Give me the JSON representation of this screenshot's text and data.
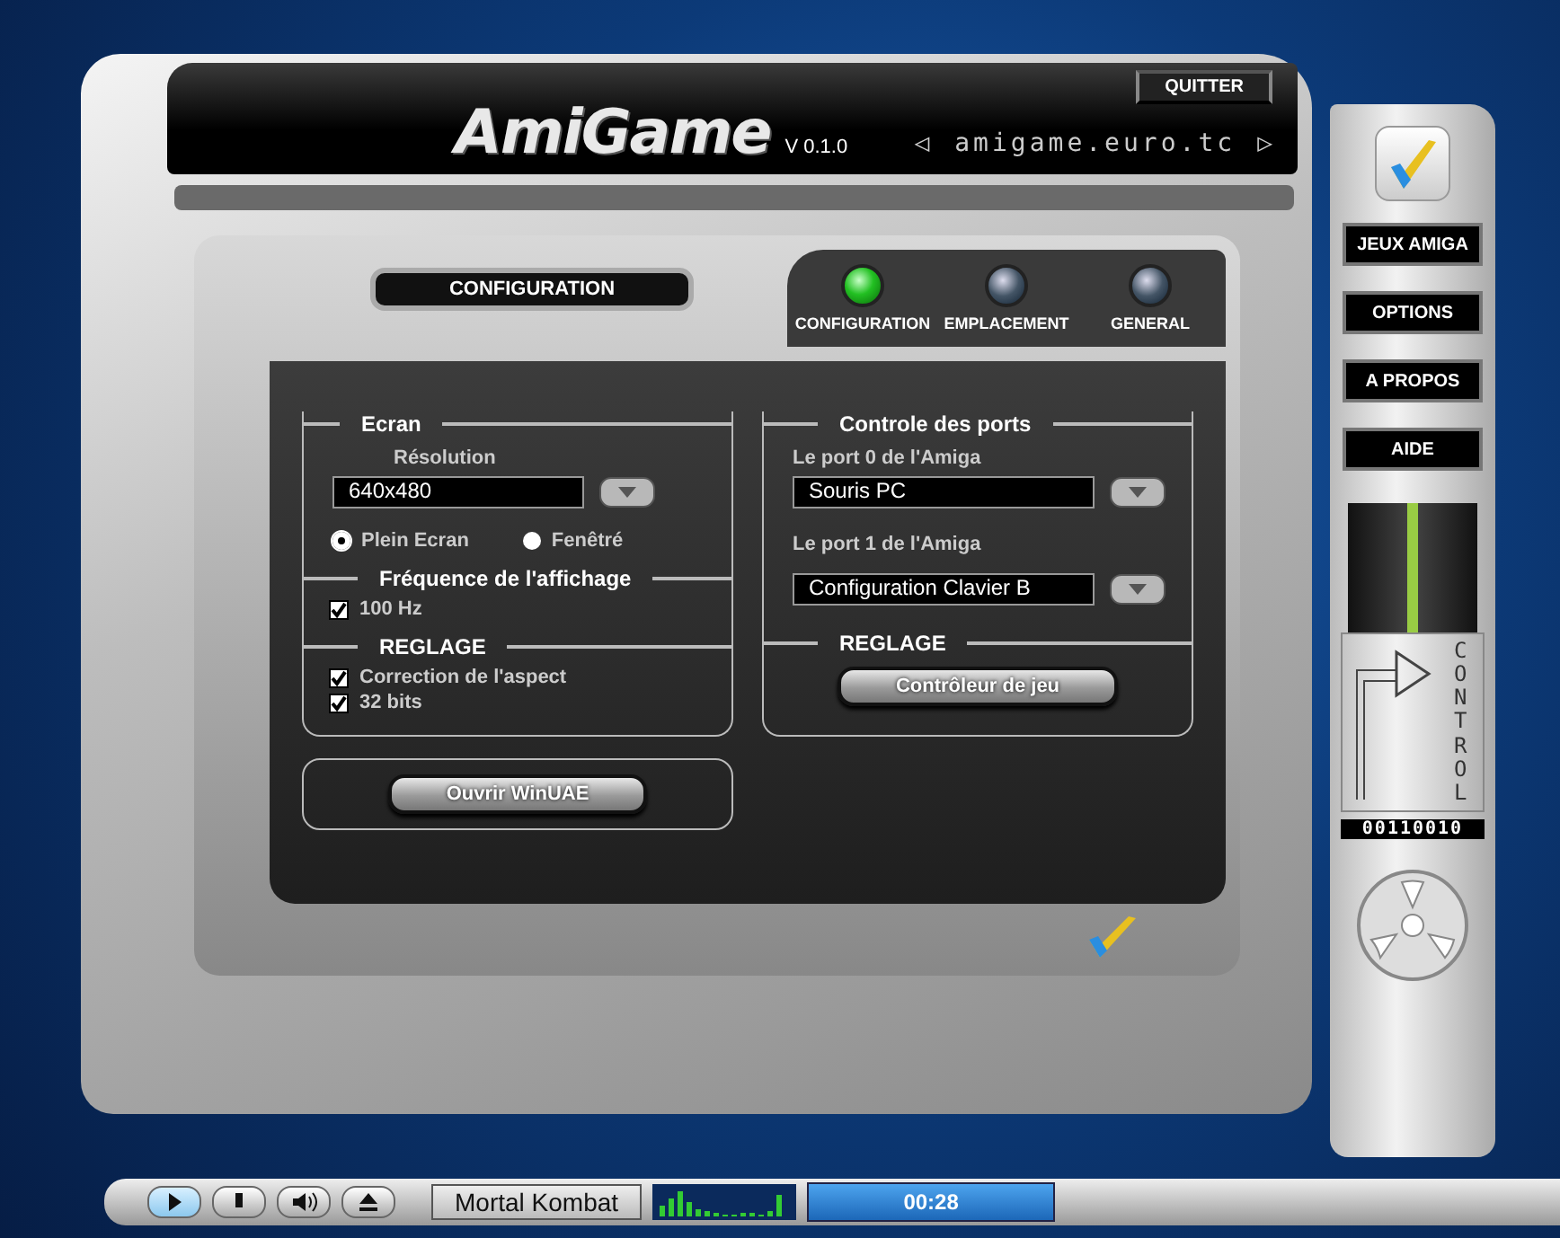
{
  "header": {
    "logo": "AmiGame",
    "version": "V 0.1.0",
    "quit": "QUITTER",
    "site_prev": "◁",
    "site": "amigame.euro.tc",
    "site_next": "▷"
  },
  "page_title": "CONFIGURATION",
  "tabs": [
    {
      "label": "CONFIGURATION",
      "selected": true
    },
    {
      "label": "EMPLACEMENT",
      "selected": false
    },
    {
      "label": "GENERAL",
      "selected": false
    }
  ],
  "ecran": {
    "title": "Ecran",
    "resolution_label": "Résolution",
    "resolution": "640x480",
    "modes": [
      {
        "label": "Plein Ecran",
        "selected": true
      },
      {
        "label": "Fenêtré",
        "selected": false
      }
    ],
    "frequency_title": "Fréquence de l'affichage",
    "frequency_options": [
      {
        "label": "100 Hz",
        "checked": true
      }
    ],
    "reglage_title": "REGLAGE",
    "reglage_options": [
      {
        "label": "Correction de l'aspect",
        "checked": true
      },
      {
        "label": "32 bits",
        "checked": true
      }
    ]
  },
  "open_button": "Ouvrir WinUAE",
  "ports": {
    "title": "Controle des ports",
    "port0_label": "Le port 0 de l'Amiga",
    "port0": "Souris PC",
    "port1_label": "Le port 1 de l'Amiga",
    "port1": "Configuration Clavier B",
    "reglage_title": "REGLAGE",
    "controller_button": "Contrôleur de jeu"
  },
  "sidebar": {
    "items": [
      {
        "label": "JEUX AMIGA"
      },
      {
        "label": "OPTIONS"
      },
      {
        "label": "A PROPOS"
      },
      {
        "label": "AIDE"
      }
    ],
    "control_label": "CONTROL",
    "binary": "00110010"
  },
  "player": {
    "buttons": [
      {
        "kind": "play",
        "active": true
      },
      {
        "kind": "stop",
        "active": false
      },
      {
        "kind": "volume",
        "active": false
      },
      {
        "kind": "eject",
        "active": false
      }
    ],
    "track": "Mortal Kombat",
    "time": "00:28"
  }
}
